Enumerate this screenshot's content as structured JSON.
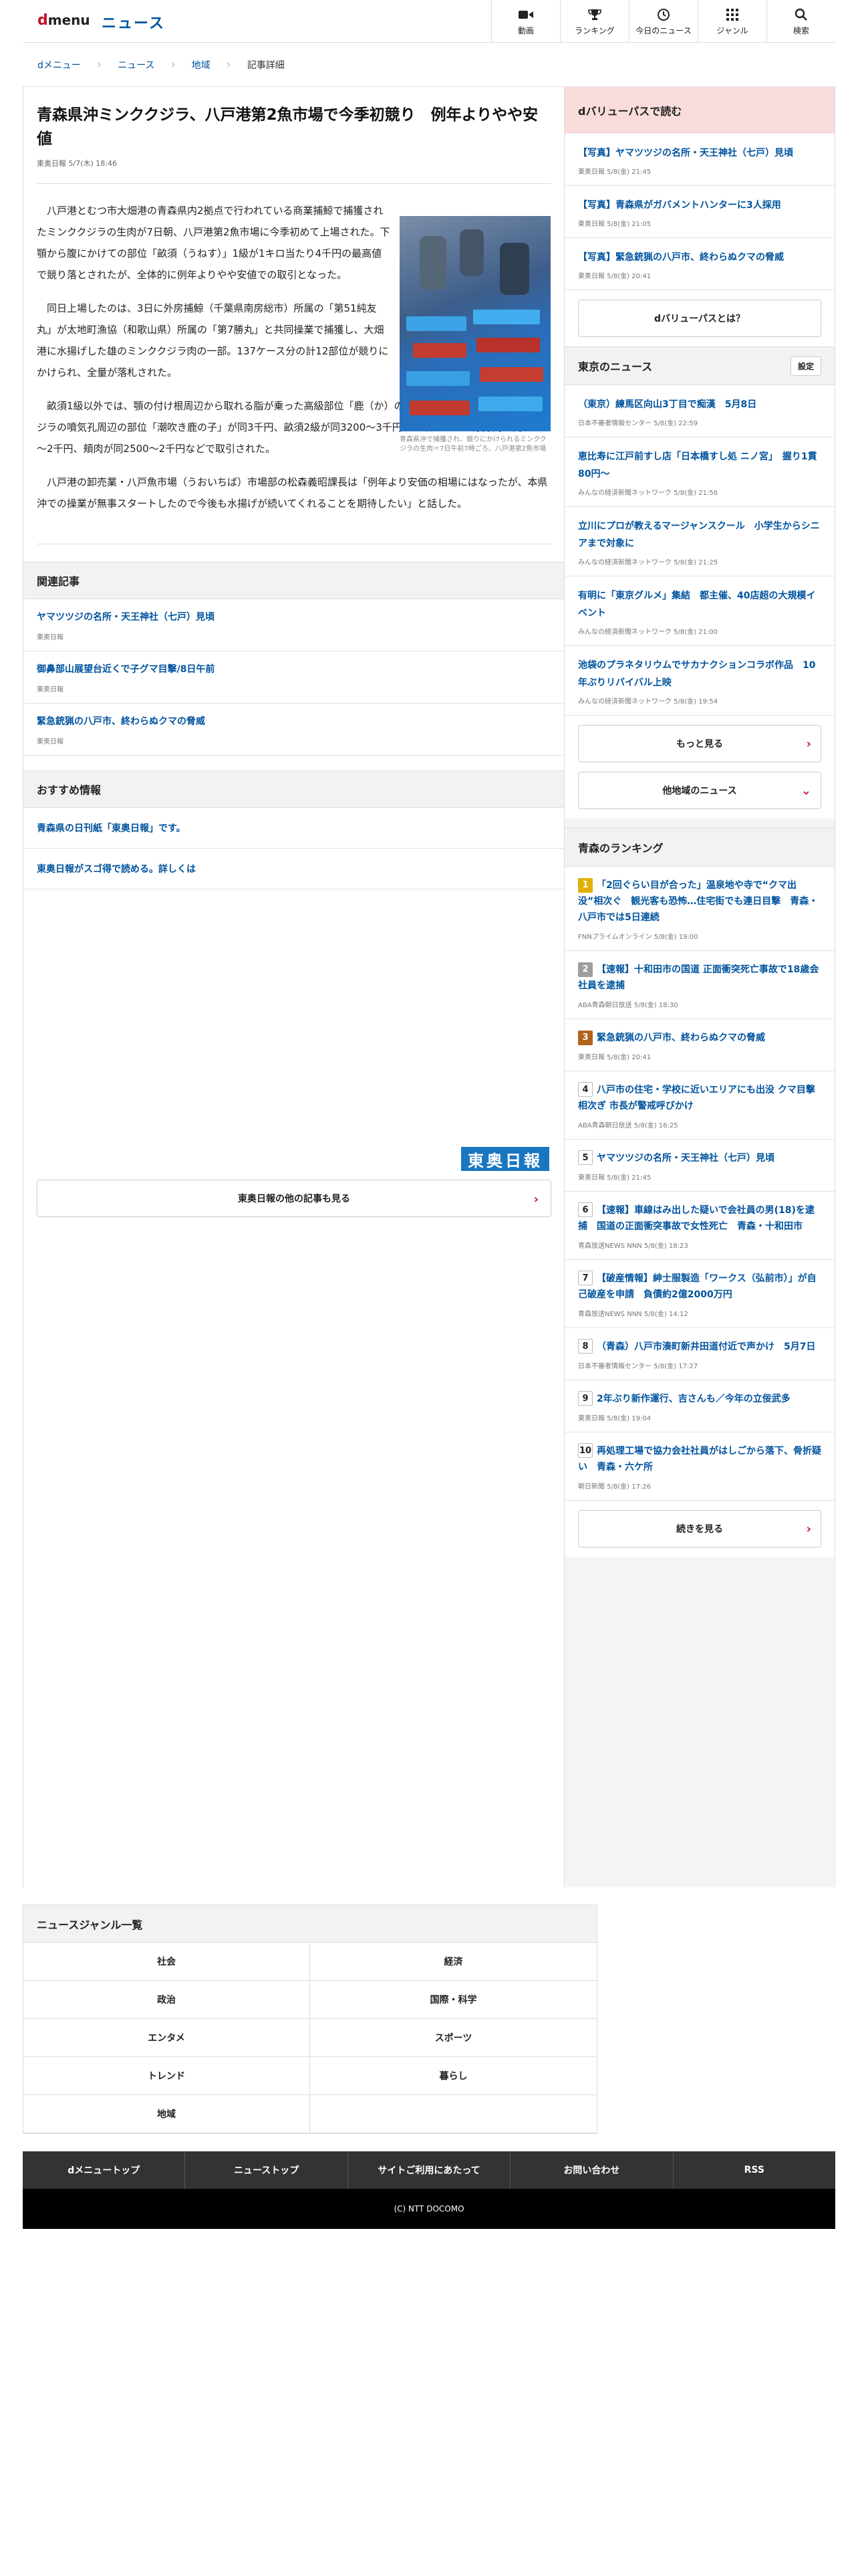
{
  "header": {
    "logo_d": "d",
    "logo_menu": "menu",
    "section": "ニュース",
    "nav": [
      {
        "label": "動画",
        "icon": "video-icon"
      },
      {
        "label": "ランキング",
        "icon": "trophy-icon"
      },
      {
        "label": "今日のニュース",
        "icon": "clock-icon"
      },
      {
        "label": "ジャンル",
        "icon": "grid-icon"
      },
      {
        "label": "検索",
        "icon": "search-icon"
      }
    ]
  },
  "breadcrumb": [
    "dメニュー",
    "ニュース",
    "地域",
    "記事詳細"
  ],
  "article": {
    "title": "青森県沖ミンククジラ、八戸港第2魚市場で今季初競り　例年よりやや安値",
    "meta": "東奥日報 5/7(木) 18:46",
    "photo_caption": "青森県沖で捕獲され、競りにかけられるミンククジラの生肉＝7日午前7時ごろ、八戸港第2魚市場",
    "paragraphs": [
      "八戸港とむつ市大畑港の青森県内2拠点で行われている商業捕鯨で捕獲されたミンククジラの生肉が7日朝、八戸港第2魚市場に今季初めて上場された。下顎から腹にかけての部位「畝須（うねす）」1級が1キロ当たり4千円の最高値で競り落とされたが、全体的に例年よりやや安値での取引となった。",
      "同日上場したのは、3日に外房捕鯨（千葉県南房総市）所属の「第51純友丸」が太地町漁協（和歌山県）所属の「第7勝丸」と共同操業で捕獲し、大畑港に水揚げした雄のミンククジラ肉の一部。137ケース分の計12部位が競りにかけられ、全量が落札された。",
      "畝須1級以外では、顎の付け根周辺から取れる脂が乗った高級部位「鹿（か）の子」が1キロ当たり3100円、クジラの噴気孔周辺の部位「潮吹き鹿の子」が同3千円、畝須2級が同3200～3千円、なじみのある赤身肉が同3200～2千円、頬肉が同2500～2千円などで取引された。",
      "八戸港の卸売業・八戸魚市場（うおいちば）市場部の松森義昭課長は「例年より安価の相場にはなったが、本県沖での操業が無事スタートしたので今後も水揚げが続いてくれることを期待したい」と話した。"
    ]
  },
  "related": {
    "heading": "関連記事",
    "items": [
      {
        "title": "ヤマツツジの名所・天王神社（七戸）見頃",
        "source": "東奥日報"
      },
      {
        "title": "御鼻部山展望台近くで子グマ目撃/8日午前",
        "source": "東奥日報"
      },
      {
        "title": "緊急銃猟の八戸市、終わらぬクマの脅威",
        "source": "東奥日報"
      }
    ]
  },
  "recommended": {
    "heading": "おすすめ情報",
    "items": [
      "青森県の日刊紙「東奥日報」です。",
      "東奥日報がスゴ得で読める。詳しくは"
    ]
  },
  "publisher_logo": "東奥日報",
  "more_publisher": "東奥日報の他の記事も見る",
  "dvalue": {
    "heading": "dバリューパスで読む",
    "items": [
      {
        "title": "【写真】ヤマツツジの名所・天王神社（七戸）見頃",
        "meta": "東奥日報 5/8(金) 21:45"
      },
      {
        "title": "【写真】青森県がガバメントハンターに3人採用",
        "meta": "東奥日報 5/8(金) 21:05"
      },
      {
        "title": "【写真】緊急銃猟の八戸市、終わらぬクマの脅威",
        "meta": "東奥日報 5/8(金) 20:41"
      }
    ],
    "about": "dバリューパスとは？"
  },
  "tokyo": {
    "heading": "東京のニュース",
    "settings": "設定",
    "items": [
      {
        "title": "（東京）練馬区向山3丁目で痴漢　5月8日",
        "meta": "日本不審者情報センター 5/8(金) 22:59"
      },
      {
        "title": "恵比寿に江戸前すし店「日本橋すし処 ニノ宮」　握り1貫80円～",
        "meta": "みんなの経済新聞ネットワーク 5/8(金) 21:56"
      },
      {
        "title": "立川にプロが教えるマージャンスクール　小学生からシニアまで対象に",
        "meta": "みんなの経済新聞ネットワーク 5/8(金) 21:25"
      },
      {
        "title": "有明に「東京グルメ」集結　都主催、40店超の大規模イベント",
        "meta": "みんなの経済新聞ネットワーク 5/8(金) 21:00"
      },
      {
        "title": "池袋のプラネタリウムでサカナクションコラボ作品　10年ぶりリバイバル上映",
        "meta": "みんなの経済新聞ネットワーク 5/8(金) 19:54"
      }
    ],
    "more": "もっと見る",
    "other_region": "他地域のニュース"
  },
  "ranking": {
    "heading": "青森のランキング",
    "colors": [
      "#e2b100",
      "#9e9e9e",
      "#b0641e",
      "#ffffff"
    ],
    "items": [
      {
        "no": "1",
        "title": "「2回ぐらい目が合った」温泉地や寺で“クマ出没”相次ぐ　観光客も恐怖…住宅街でも連日目撃　青森・八戸市では5日連続",
        "meta": "FNNプライムオンライン 5/8(金) 19:00"
      },
      {
        "no": "2",
        "title": "【速報】十和田市の国道 正面衝突死亡事故で18歳会社員を逮捕",
        "meta": "ABA青森朝日放送 5/8(金) 18:30"
      },
      {
        "no": "3",
        "title": "緊急銃猟の八戸市、終わらぬクマの脅威",
        "meta": "東奥日報 5/8(金) 20:41"
      },
      {
        "no": "4",
        "title": "八戸市の住宅・学校に近いエリアにも出没 クマ目撃相次ぎ 市長が警戒呼びかけ",
        "meta": "ABA青森朝日放送 5/8(金) 16:25"
      },
      {
        "no": "5",
        "title": "ヤマツツジの名所・天王神社（七戸）見頃",
        "meta": "東奥日報 5/8(金) 21:45"
      },
      {
        "no": "6",
        "title": "【速報】車線はみ出した疑いで会社員の男(18)を逮捕　国道の正面衝突事故で女性死亡　青森・十和田市",
        "meta": "青森放送NEWS NNN 5/8(金) 18:23"
      },
      {
        "no": "7",
        "title": "【破産情報】紳士服製造「ワークス（弘前市）」が自己破産を申請　負債約2億2000万円",
        "meta": "青森放送NEWS NNN 5/8(金) 14:12"
      },
      {
        "no": "8",
        "title": "（青森）八戸市湊町新井田道付近で声かけ　5月7日",
        "meta": "日本不審者情報センター 5/8(金) 17:27"
      },
      {
        "no": "9",
        "title": "2年ぶり新作運行、吉さんも／今年の立佞武多",
        "meta": "東奥日報 5/8(金) 19:04"
      },
      {
        "no": "10",
        "title": "再処理工場で協力会社社員がはしごから落下、骨折疑い　青森・六ケ所",
        "meta": "朝日新聞 5/8(金) 17:26"
      }
    ],
    "more": "続きを見る"
  },
  "genres": {
    "heading": "ニュースジャンル一覧",
    "items": [
      "社会",
      "経済",
      "政治",
      "国際・科学",
      "エンタメ",
      "スポーツ",
      "トレンド",
      "暮らし",
      "地域",
      ""
    ]
  },
  "footer": {
    "nav": [
      "dメニュートップ",
      "ニューストップ",
      "サイトご利用にあたって",
      "お問い合わせ",
      "RSS"
    ],
    "copyright": "(C) NTT DOCOMO"
  }
}
